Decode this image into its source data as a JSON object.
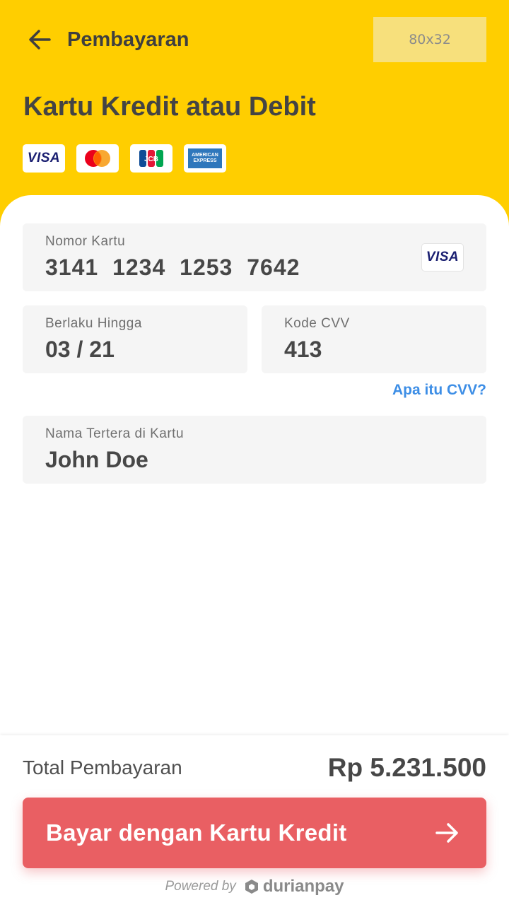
{
  "header": {
    "back_title": "Pembayaran",
    "placeholder_label": "80x32",
    "page_title": "Kartu Kredit atau Debit",
    "accent_color": "#FFCE00",
    "card_logos": [
      "visa-logo",
      "mastercard-logo",
      "jcb-logo",
      "amex-logo"
    ],
    "visa_text": "VISA",
    "jcb_text": "JCB",
    "amex_line1": "AMERICAN",
    "amex_line2": "EXPRESS"
  },
  "form": {
    "card_number": {
      "label": "Nomor Kartu",
      "value": "3141 1234 1253 7642",
      "brand": "VISA"
    },
    "expiry": {
      "label": "Berlaku Hingga",
      "value": "03 / 21"
    },
    "cvv": {
      "label": "Kode CVV",
      "value": "413"
    },
    "cvv_help": "Apa itu CVV?",
    "name": {
      "label": "Nama Tertera di Kartu",
      "value": "John Doe"
    }
  },
  "footer": {
    "total_label": "Total Pembayaran",
    "total_amount": "Rp 5.231.500",
    "pay_button": "Bayar dengan Kartu Kredit",
    "button_color": "#E95F63",
    "powered_by": "Powered by",
    "brand": "durianpay"
  }
}
